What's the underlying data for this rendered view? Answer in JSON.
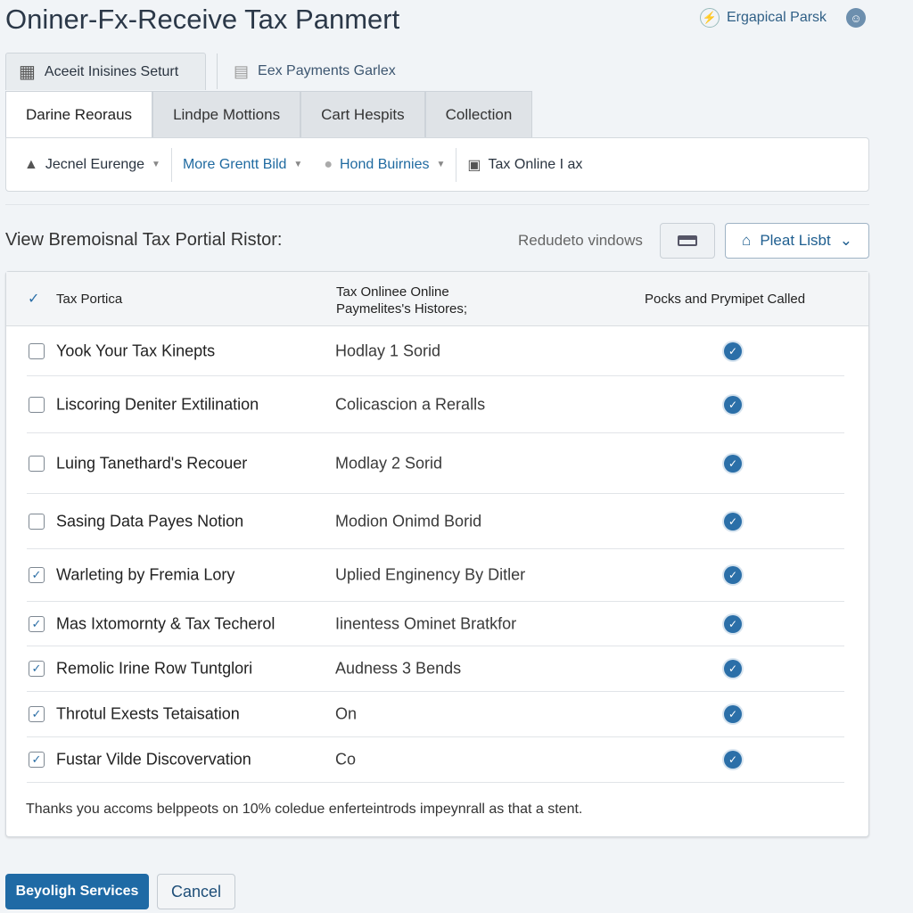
{
  "title": "Oniner-Fx-Receive Tax Panmert",
  "user": {
    "name": "Ergapical Parsk"
  },
  "top_buttons": [
    "Aceeit Inisines Seturt",
    "Eex Payments Garlex"
  ],
  "tabs": [
    "Darine Reoraus",
    "Lindpe Mottions",
    "Cart Hespits",
    "Collection"
  ],
  "toolbar": [
    "Jecnel Eurenge",
    "More Grentt Bild",
    "Hond Buirnies",
    "Tax Online I ax"
  ],
  "subtitle": "View Bremoisnal Tax Portial Ristor:",
  "reduce_label": "Redudeto vindows",
  "plist_label": "Pleat Lisbt",
  "table": {
    "headers": [
      "Tax Portica",
      "Tax Onlinee Online Paymelites's Histores;",
      "Pocks and Prymipet Called"
    ],
    "rows": [
      {
        "name": "Yook Your Tax Kinepts",
        "detail": "Hodlay 1 Sorid",
        "selected": false,
        "called": true
      },
      {
        "name": "Liscoring Deniter Extilination",
        "detail": "Colicascion a Reralls",
        "selected": false,
        "called": true
      },
      {
        "name": "Luing Tanethard's Recouer",
        "detail": "Modlay 2 Sorid",
        "selected": false,
        "called": true
      },
      {
        "name": "Sasing Data Payes Notion",
        "detail": "Modion Onimd Borid",
        "selected": false,
        "called": true
      },
      {
        "name": "Warleting by Fremia Lory",
        "detail": "Uplied Enginency By Ditler",
        "selected": true,
        "called": true
      },
      {
        "name": "Mas Ixtomornty & Tax Techerol",
        "detail": "Iinentess Ominet Bratkfor",
        "selected": true,
        "called": true
      },
      {
        "name": "Remolic Irine Row Tuntglori",
        "detail": "Audness 3 Bends",
        "selected": true,
        "called": true
      },
      {
        "name": "Throtul Exests Tetaisation",
        "detail": "On",
        "selected": true,
        "called": true
      },
      {
        "name": "Fustar Vilde Discovervation",
        "detail": "Co",
        "selected": true,
        "called": true
      }
    ],
    "note": "Thanks you accoms belppeots on 10% coledue enferteintrods impeynrall as that a stent."
  },
  "actions": {
    "primary": "Beyoligh Services",
    "cancel": "Cancel"
  },
  "colors": {
    "accent": "#1f6aa5",
    "check": "#2b6fa8"
  }
}
